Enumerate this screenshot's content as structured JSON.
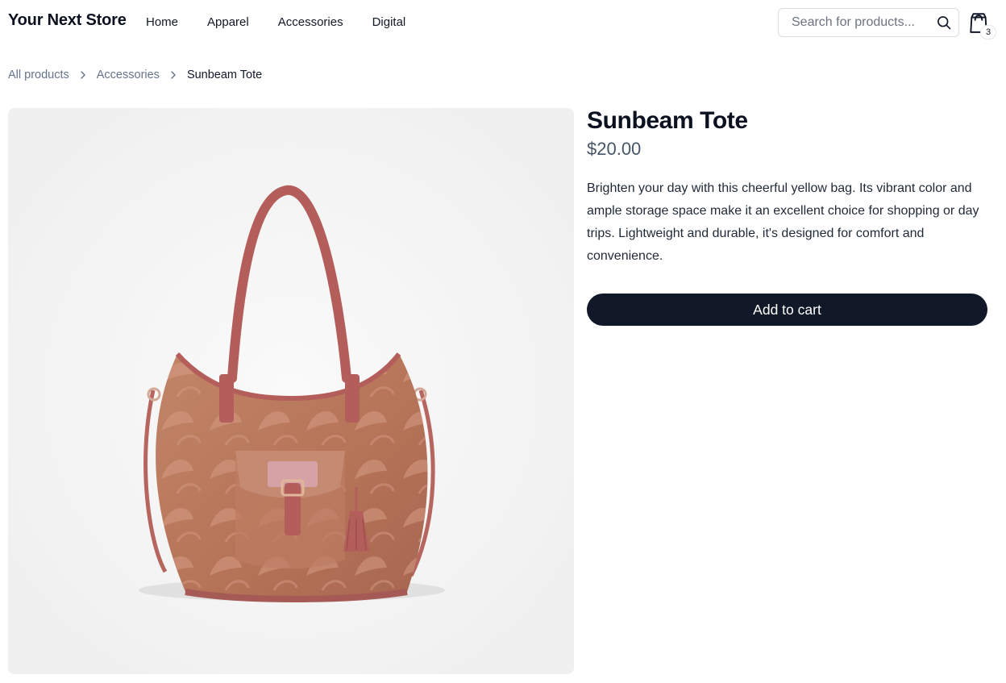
{
  "store": {
    "name": "Your Next Store"
  },
  "nav": {
    "items": [
      "Home",
      "Apparel",
      "Accessories",
      "Digital"
    ]
  },
  "search": {
    "placeholder": "Search for products...",
    "value": ""
  },
  "cart": {
    "count": "3"
  },
  "breadcrumb": {
    "items": [
      "All products",
      "Accessories"
    ],
    "current": "Sunbeam Tote"
  },
  "product": {
    "title": "Sunbeam Tote",
    "price": "$20.00",
    "description": "Brighten your day with this cheerful yellow bag. Its vibrant color and ample storage space make it an excellent choice for shopping or day trips. Lightweight and durable, it's designed for comfort and convenience.",
    "add_to_cart_label": "Add to cart",
    "image": {
      "icon": "tote-bag-photo",
      "bag_color": "#b97a5e",
      "strap_color": "#b45e5b",
      "background": "#f3f3f3"
    }
  },
  "colors": {
    "primary_button": "#111827",
    "muted_text": "#64748b"
  }
}
